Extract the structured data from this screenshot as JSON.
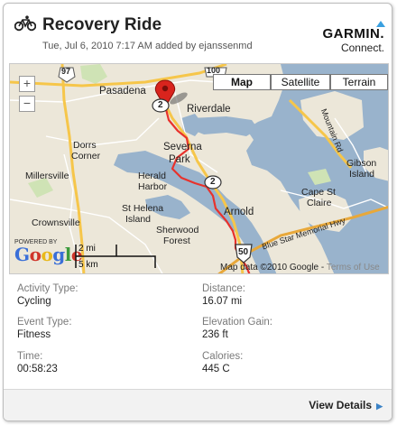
{
  "header": {
    "title": "Recovery Ride",
    "subtitle": "Tue, Jul 6, 2010 7:17 AM added by ejanssenmd",
    "logo_word": "GARMIN.",
    "logo_sub": "Connect."
  },
  "map": {
    "zoom_in": "+",
    "zoom_out": "−",
    "types": {
      "map": "Map",
      "satellite": "Satellite",
      "terrain": "Terrain"
    },
    "places": {
      "pasadena": "Pasadena",
      "riverdale": "Riverdale",
      "severna": "Severna",
      "park": "Park",
      "dorrs": "Dorrs",
      "corner": "Corner",
      "millersville": "Millersville",
      "herald": "Herald",
      "harbor": "Harbor",
      "st_helena": "St Helena",
      "island": "Island",
      "crownsville": "Crownsville",
      "sherwood": "Sherwood",
      "forest": "Forest",
      "arnold": "Arnold",
      "cape_st": "Cape St",
      "claire": "Claire",
      "gibson": "Gibson",
      "island2": "Island",
      "mountain_rd": "Mountain Rd",
      "blue_star": "Blue Star Memorial Hwy"
    },
    "shields": {
      "r100": "100",
      "r97": "97",
      "r2a": "2",
      "r2b": "2",
      "r50": "50"
    },
    "scale": {
      "mi": "2 mi",
      "km": "5 km"
    },
    "powered_by": "POWERED BY",
    "google": "Google",
    "attribution": "Map data ©2010 Google -",
    "terms": "Terms of Use"
  },
  "stats": {
    "activity_type": {
      "label": "Activity Type:",
      "value": "Cycling"
    },
    "distance": {
      "label": "Distance:",
      "value": "16.07 mi"
    },
    "event_type": {
      "label": "Event Type:",
      "value": "Fitness"
    },
    "elevation_gain": {
      "label": "Elevation Gain:",
      "value": "236 ft"
    },
    "time": {
      "label": "Time:",
      "value": "00:58:23"
    },
    "calories": {
      "label": "Calories:",
      "value": "445 C"
    }
  },
  "footer": {
    "view_details": "View Details"
  },
  "colors": {
    "route": "#e8322c",
    "water": "#99b3cc",
    "land": "#ece7d9",
    "major_road": "#f6c64a",
    "accent": "#3a82c6"
  }
}
